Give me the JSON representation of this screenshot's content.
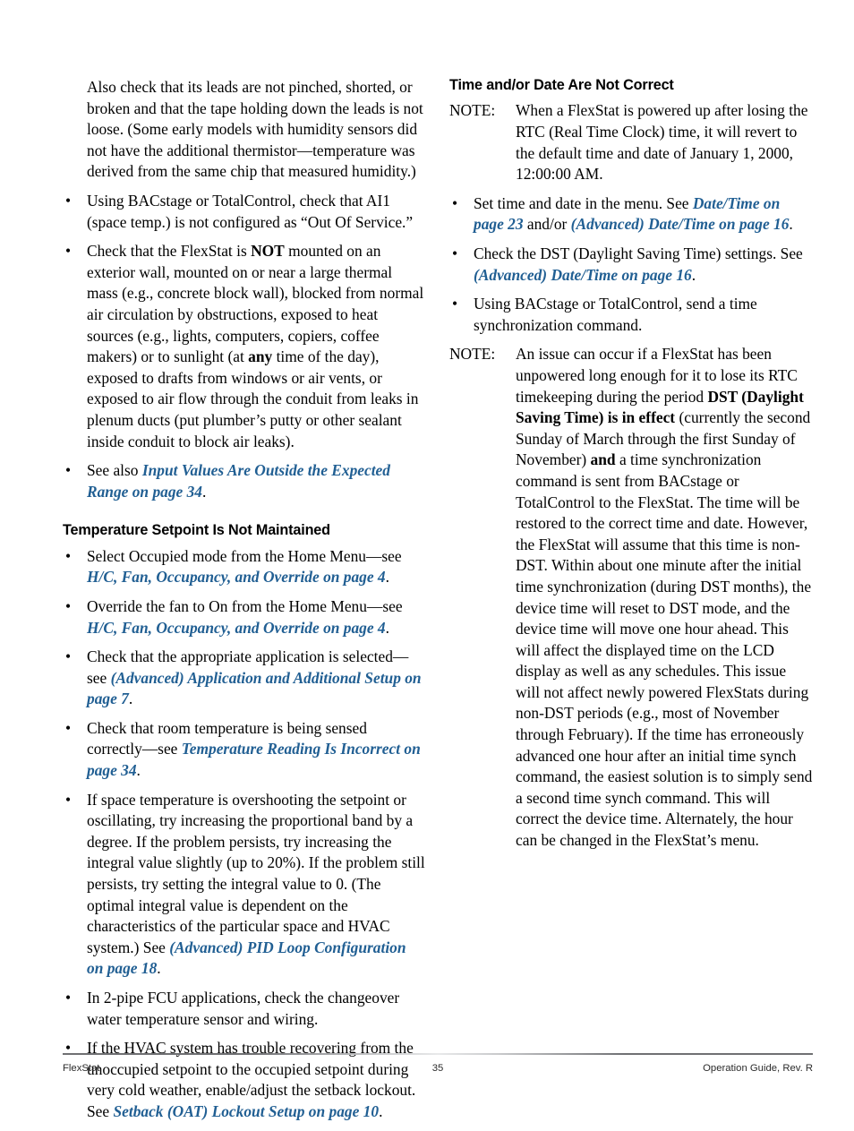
{
  "page": {
    "number": "35",
    "footer_left": "FlexStat",
    "footer_right": "Operation Guide, Rev. R"
  },
  "left_column": {
    "continuation_paragraph": "Also check that its leads are not pinched, shorted, or broken and that the tape holding down the leads is not loose. (Some early models with humidity sensors did not have the additional thermistor—temperature was derived from the same chip that measured humidity.)",
    "bullets": [
      {
        "segments": [
          {
            "type": "text",
            "value": "Using BACstage or TotalControl, check that AI1 (space temp.) is not configured as “Out Of Service.”"
          }
        ]
      },
      {
        "segments": [
          {
            "type": "text",
            "value": "Check that the FlexStat is "
          },
          {
            "type": "bold",
            "value": "NOT"
          },
          {
            "type": "text",
            "value": " mounted on an exterior wall, mounted on or near a large thermal mass (e.g., concrete block wall), blocked from normal air circulation by obstructions, exposed to heat sources (e.g., lights, computers, copiers, coffee makers) or to sunlight (at "
          },
          {
            "type": "bold",
            "value": "any"
          },
          {
            "type": "text",
            "value": " time of the day), exposed to drafts from windows or air vents, or exposed to air flow through the conduit from leaks in plenum ducts (put plumber’s putty or other sealant inside conduit to block air leaks)."
          }
        ]
      },
      {
        "segments": [
          {
            "type": "text",
            "value": "See also "
          },
          {
            "type": "xref",
            "value": "Input Values Are Outside the Expected Range on page 34"
          },
          {
            "type": "text",
            "value": "."
          }
        ]
      }
    ],
    "heading": "Temperature Setpoint Is Not Maintained",
    "heading_bullets": [
      {
        "segments": [
          {
            "type": "text",
            "value": "Select Occupied mode from the Home Menu—see "
          },
          {
            "type": "xref",
            "value": "H/C, Fan, Occupancy, and Override on page 4"
          },
          {
            "type": "text",
            "value": "."
          }
        ]
      },
      {
        "segments": [
          {
            "type": "text",
            "value": "Override the fan to On from the Home Menu—see "
          },
          {
            "type": "xref",
            "value": "H/C, Fan, Occupancy, and Override on page 4"
          },
          {
            "type": "text",
            "value": "."
          }
        ]
      },
      {
        "segments": [
          {
            "type": "text",
            "value": "Check that the appropriate application is selected—see "
          },
          {
            "type": "xref",
            "value": "(Advanced) Application and Additional Setup on page 7"
          },
          {
            "type": "text",
            "value": "."
          }
        ]
      },
      {
        "segments": [
          {
            "type": "text",
            "value": "Check that room temperature is being sensed correctly—see "
          },
          {
            "type": "xref",
            "value": "Temperature Reading Is Incorrect on page 34"
          },
          {
            "type": "text",
            "value": "."
          }
        ]
      },
      {
        "segments": [
          {
            "type": "text",
            "value": "If space temperature is overshooting the setpoint or oscillating, try increasing the proportional band by a degree. If the problem persists, try increasing the integral value slightly (up to 20%). If the problem still persists, try setting the integral value to 0. (The optimal integral value is dependent on the characteristics of the particular space and HVAC system.) See "
          },
          {
            "type": "xref",
            "value": "(Advanced) PID Loop Configuration on page 18"
          },
          {
            "type": "text",
            "value": "."
          }
        ]
      },
      {
        "segments": [
          {
            "type": "text",
            "value": "In 2-pipe FCU applications, check the changeover water temperature sensor and wiring."
          }
        ]
      },
      {
        "segments": [
          {
            "type": "text",
            "value": "If the HVAC system has trouble recovering from the unoccupied setpoint to the occupied setpoint during very cold weather, enable/adjust the setback lockout. See "
          },
          {
            "type": "xref",
            "value": "Setback (OAT) Lockout Setup on page 10"
          },
          {
            "type": "text",
            "value": "."
          }
        ]
      }
    ]
  },
  "right_column": {
    "heading": "Time and/or Date Are Not Correct",
    "note_label": "NOTE:",
    "note_1": "When a FlexStat is powered up after losing the RTC (Real Time Clock) time, it will revert to the default time and date of January 1, 2000, 12:00:00 AM.",
    "bullets": [
      {
        "segments": [
          {
            "type": "text",
            "value": "Set time and date in the menu. See "
          },
          {
            "type": "xref",
            "value": "Date/Time on page 23"
          },
          {
            "type": "text",
            "value": " and/or "
          },
          {
            "type": "xref",
            "value": "(Advanced) Date/Time on page 16"
          },
          {
            "type": "text",
            "value": "."
          }
        ]
      },
      {
        "segments": [
          {
            "type": "text",
            "value": "Check the DST (Daylight Saving Time) settings. See "
          },
          {
            "type": "xref",
            "value": "(Advanced) Date/Time on page 16"
          },
          {
            "type": "text",
            "value": "."
          }
        ]
      },
      {
        "segments": [
          {
            "type": "text",
            "value": "Using BACstage or TotalControl, send a time synchronization command."
          }
        ]
      }
    ],
    "note_2_segments": [
      {
        "type": "text",
        "value": "An issue can occur if a FlexStat has been unpowered long enough for it to lose its RTC timekeeping during the period "
      },
      {
        "type": "bold",
        "value": "DST (Daylight Saving Time) is in effect"
      },
      {
        "type": "text",
        "value": " (currently the second Sunday of March through the first Sunday of November) "
      },
      {
        "type": "bold",
        "value": "and"
      },
      {
        "type": "text",
        "value": " a time synchronization command is sent from BACstage or TotalControl to the FlexStat. The time will be restored to the correct time and date. However, the FlexStat will assume that this time is non-DST. Within about one minute after the initial time synchronization (during DST months), the device time will reset to DST mode, and the device time will move one hour ahead. This will affect the displayed time on the LCD display as well as any schedules. This issue will not affect newly powered FlexStats during non-DST periods (e.g., most of November through February). If the time has erroneously advanced one hour after an initial time synch command, the easiest solution is to simply send a second time synch command. This will correct the device time. Alternately, the hour can be changed in the FlexStat’s menu."
      }
    ],
    "bullet_glyph": "•"
  }
}
